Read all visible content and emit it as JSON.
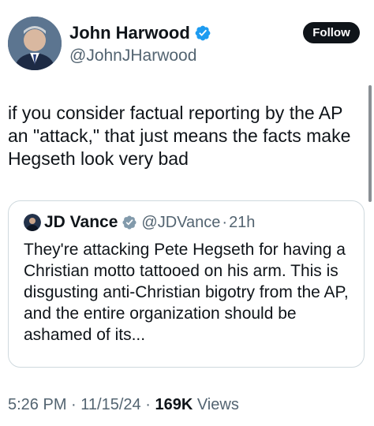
{
  "author": {
    "display_name": "John Harwood",
    "handle": "@JohnJHarwood",
    "verified_icon": "verified-badge-icon",
    "verified_color": "#1d9bf0"
  },
  "follow_label": "Follow",
  "tweet_text": "if you consider factual reporting by the AP an \"attack,\" that just means the facts make Hegseth look very bad",
  "quote": {
    "display_name": "JD Vance",
    "handle": "@JDVance",
    "separator": "·",
    "time": "21h",
    "badge_icon": "government-badge-icon",
    "badge_color": "#829aab",
    "text": "They're attacking Pete Hegseth for having a Christian motto tattooed on his arm. This is disgusting anti-Christian bigotry from the AP, and the entire organization should be ashamed of its..."
  },
  "meta": {
    "time": "5:26 PM",
    "dot1": "·",
    "date": "11/15/24",
    "dot2": "·",
    "views_count": "169K",
    "views_label": "Views"
  },
  "colors": {
    "text": "#0f1419",
    "secondary": "#536471",
    "border": "#cfd9de",
    "button_bg": "#0f1419"
  }
}
